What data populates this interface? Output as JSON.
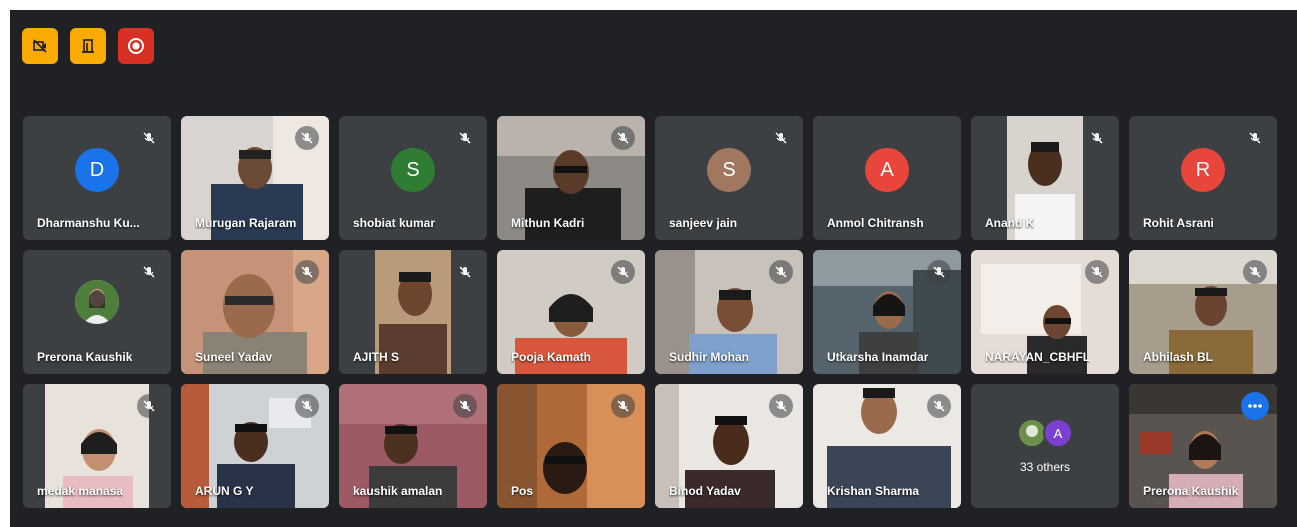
{
  "toolbar": {
    "buttons": [
      {
        "icon": "video-off-icon",
        "color": "#f9ab00"
      },
      {
        "icon": "door-exit-icon",
        "color": "#f9ab00"
      },
      {
        "icon": "record-icon",
        "color": "#d93025"
      }
    ]
  },
  "participants": [
    {
      "name": "Dharmanshu Ku...",
      "initial": "D",
      "avatar_color": "#1a73e8"
    },
    {
      "name": "Murugan Rajaram"
    },
    {
      "name": "shobiat kumar",
      "initial": "S",
      "avatar_color": "#2e7d32"
    },
    {
      "name": "Mithun Kadri"
    },
    {
      "name": "sanjeev jain",
      "initial": "S",
      "avatar_color": "#a1785f"
    },
    {
      "name": "Anmol Chitransh",
      "initial": "A",
      "avatar_color": "#e8453c"
    },
    {
      "name": "Anand K"
    },
    {
      "name": "Rohit Asrani",
      "initial": "R",
      "avatar_color": "#e8453c"
    },
    {
      "name": "Prerona Kaushik"
    },
    {
      "name": "Suneel Yadav"
    },
    {
      "name": "AJITH S"
    },
    {
      "name": "Pooja Kamath"
    },
    {
      "name": "Sudhir Mohan"
    },
    {
      "name": "Utkarsha Inamdar"
    },
    {
      "name": "NARAYAN_CBHFL"
    },
    {
      "name": "Abhilash BL"
    },
    {
      "name": "medak manasa"
    },
    {
      "name": "ARUN G Y"
    },
    {
      "name": "kaushik amalan"
    },
    {
      "name": "Pos"
    },
    {
      "name": "Binod Yadav"
    },
    {
      "name": "Krishan Sharma"
    }
  ],
  "others": {
    "initial": "A",
    "label": "33 others"
  },
  "self_tile": {
    "name": "Prerona Kaushik"
  }
}
